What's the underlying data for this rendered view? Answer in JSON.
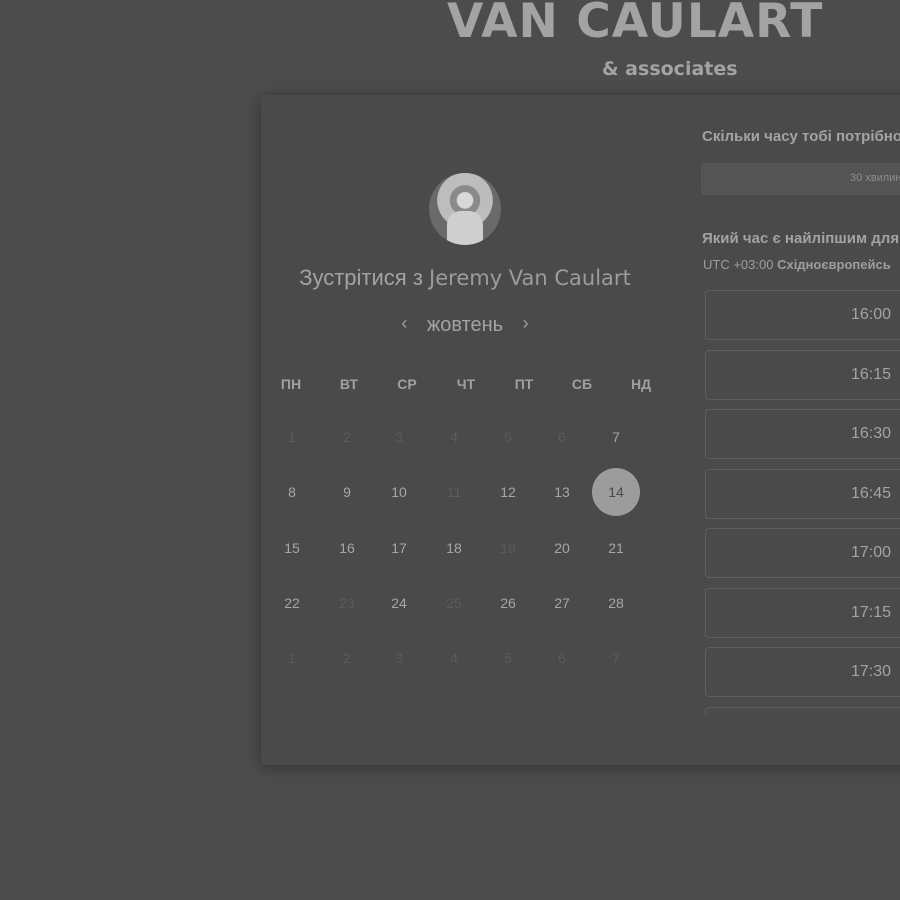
{
  "brand": {
    "name": "VAN CAULART",
    "subtitle": "& associates"
  },
  "profile": {
    "meet_prefix": "Зустрітися з",
    "host_name": "Jeremy Van Caulart"
  },
  "calendar": {
    "month": "жовтень",
    "prev_icon": "‹",
    "next_icon": "›",
    "weekdays": [
      "ПН",
      "ВТ",
      "СР",
      "ЧТ",
      "ПТ",
      "СБ",
      "НД"
    ],
    "weeks": [
      [
        {
          "d": "1",
          "state": "dim"
        },
        {
          "d": "2",
          "state": "dim"
        },
        {
          "d": "3",
          "state": "dim"
        },
        {
          "d": "4",
          "state": "dim"
        },
        {
          "d": "5",
          "state": "dim"
        },
        {
          "d": "6",
          "state": "dim"
        },
        {
          "d": "7",
          "state": "available"
        }
      ],
      [
        {
          "d": "8",
          "state": "available"
        },
        {
          "d": "9",
          "state": "available"
        },
        {
          "d": "10",
          "state": "available"
        },
        {
          "d": "11",
          "state": "dim"
        },
        {
          "d": "12",
          "state": "available"
        },
        {
          "d": "13",
          "state": "available"
        },
        {
          "d": "14",
          "state": "selected"
        }
      ],
      [
        {
          "d": "15",
          "state": "available"
        },
        {
          "d": "16",
          "state": "available"
        },
        {
          "d": "17",
          "state": "available"
        },
        {
          "d": "18",
          "state": "available"
        },
        {
          "d": "19",
          "state": "dim"
        },
        {
          "d": "20",
          "state": "available"
        },
        {
          "d": "21",
          "state": "available"
        }
      ],
      [
        {
          "d": "22",
          "state": "available"
        },
        {
          "d": "23",
          "state": "dim"
        },
        {
          "d": "24",
          "state": "available"
        },
        {
          "d": "25",
          "state": "dim"
        },
        {
          "d": "26",
          "state": "available"
        },
        {
          "d": "27",
          "state": "available"
        },
        {
          "d": "28",
          "state": "available"
        }
      ],
      [
        {
          "d": "1",
          "state": "dim"
        },
        {
          "d": "2",
          "state": "dim"
        },
        {
          "d": "3",
          "state": "dim"
        },
        {
          "d": "4",
          "state": "dim"
        },
        {
          "d": "5",
          "state": "dim"
        },
        {
          "d": "6",
          "state": "dim"
        },
        {
          "d": "7",
          "state": "dim"
        }
      ]
    ]
  },
  "booking": {
    "duration_question": "Скільки часу тобі потрібно",
    "duration_value": "30 хвилин",
    "time_question": "Який час є найліпшим для",
    "timezone_offset": "UTC +03:00",
    "timezone_name": "Східноєвропейсь",
    "slots": [
      "16:00",
      "16:15",
      "16:30",
      "16:45",
      "17:00",
      "17:15",
      "17:30",
      ""
    ]
  },
  "colors": {
    "background": "#4c4c4c",
    "card": "#4a4a4a",
    "text": "#a3a3a3",
    "selected_day": "#9c9c9c"
  }
}
